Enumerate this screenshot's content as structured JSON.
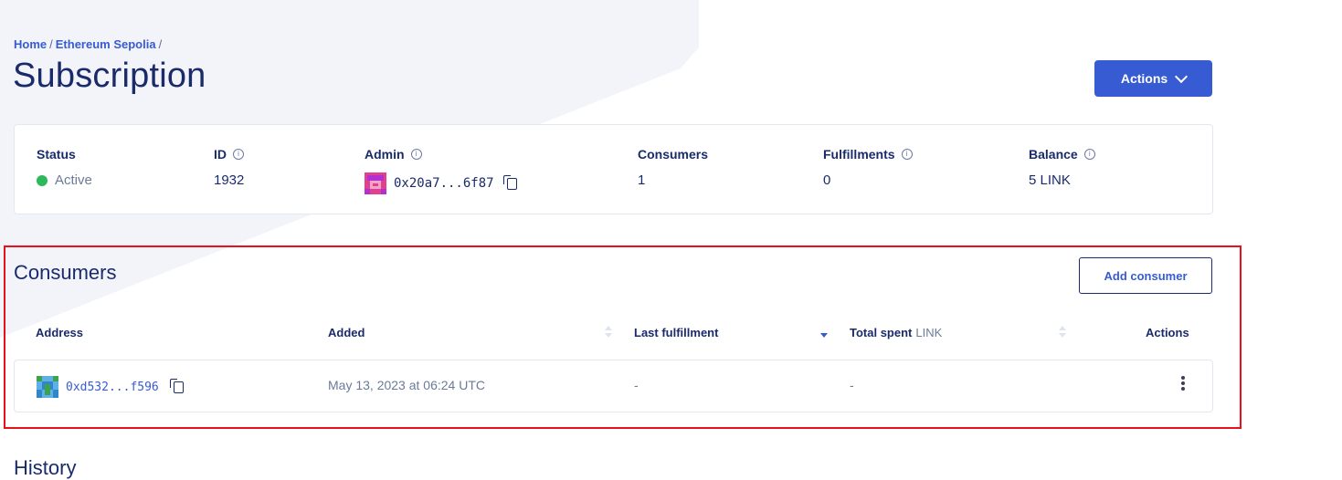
{
  "breadcrumb": {
    "home": "Home",
    "network": "Ethereum Sepolia",
    "sep": "/"
  },
  "page": {
    "title": "Subscription",
    "actions_label": "Actions"
  },
  "summary": {
    "status": {
      "label": "Status",
      "value": "Active"
    },
    "id": {
      "label": "ID",
      "value": "1932"
    },
    "admin": {
      "label": "Admin",
      "value": "0x20a7...6f87"
    },
    "consumers": {
      "label": "Consumers",
      "value": "1"
    },
    "fulfillments": {
      "label": "Fulfillments",
      "value": "0"
    },
    "balance": {
      "label": "Balance",
      "value": "5 LINK"
    }
  },
  "consumers_section": {
    "title": "Consumers",
    "add_label": "Add consumer",
    "columns": {
      "address": "Address",
      "added": "Added",
      "last_fulfillment": "Last fulfillment",
      "total_spent": "Total spent",
      "total_spent_unit": "LINK",
      "actions": "Actions"
    },
    "rows": [
      {
        "address": "0xd532...f596",
        "added": "May 13, 2023 at 06:24 UTC",
        "last_fulfillment": "-",
        "total_spent": "-"
      }
    ]
  },
  "history_section": {
    "title": "History"
  },
  "colors": {
    "accent": "#375bd2",
    "text": "#1a2b6b",
    "active": "#2eb85c",
    "highlight": "#e8101a",
    "background_shape": "#f3f4f9"
  }
}
